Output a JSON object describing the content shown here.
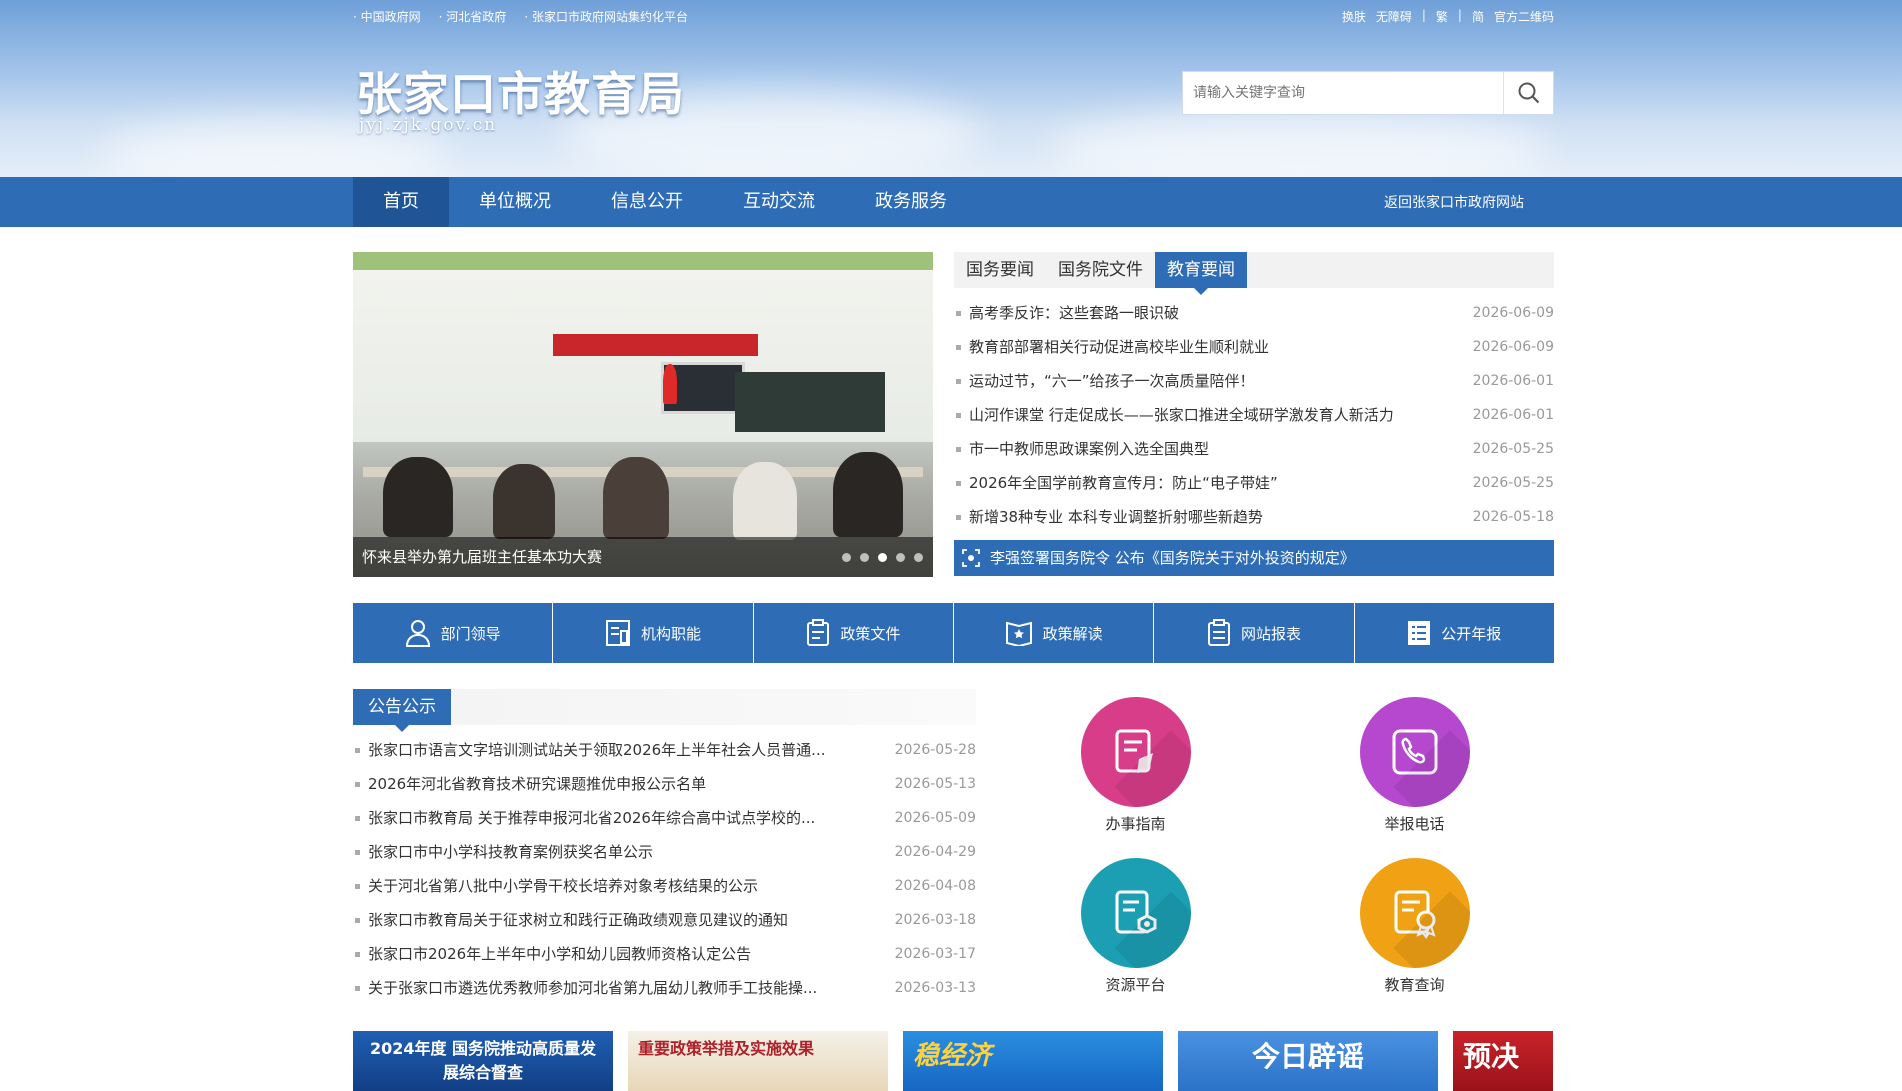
{
  "top_links": [
    "中国政府网",
    "河北省政府",
    "张家口市政府网站集约化平台"
  ],
  "toolbar": {
    "skin": "换肤",
    "accessible": "无障碍",
    "trad": "繁",
    "simp": "简",
    "qrcode": "官方二维码"
  },
  "site": {
    "title": "张家口市教育局",
    "url": "jyj.zjk.gov.cn"
  },
  "search": {
    "placeholder": "请输入关键字查询"
  },
  "nav": {
    "items": [
      "首页",
      "单位概况",
      "信息公开",
      "互动交流",
      "政务服务"
    ],
    "active": "首页",
    "back": "返回张家口市政府网站"
  },
  "slider": {
    "caption": "怀来县举办第九届班主任基本功大赛",
    "dots": 5,
    "active_dot": 3
  },
  "news": {
    "tabs": [
      "国务要闻",
      "国务院文件",
      "教育要闻"
    ],
    "active_tab": "教育要闻",
    "items": [
      {
        "title": "高考季反诈：这些套路一眼识破",
        "date": "2026-06-09"
      },
      {
        "title": "教育部部署相关行动促进高校毕业生顺利就业",
        "date": "2026-06-09"
      },
      {
        "title": "运动过节，“六一”给孩子一次高质量陪伴！",
        "date": "2026-06-01"
      },
      {
        "title": "山河作课堂 行走促成长——张家口推进全域研学激发育人新活力",
        "date": "2026-06-01"
      },
      {
        "title": "市一中教师思政课案例入选全国典型",
        "date": "2026-05-25"
      },
      {
        "title": "2026年全国学前教育宣传月：防止“电子带娃”",
        "date": "2026-05-25"
      },
      {
        "title": "新增38种专业 本科专业调整折射哪些新趋势",
        "date": "2026-05-18"
      }
    ],
    "notice": "李强签署国务院令 公布《国务院关于对外投资的规定》"
  },
  "quick": [
    "部门领导",
    "机构职能",
    "政策文件",
    "政策解读",
    "网站报表",
    "公开年报"
  ],
  "announce": {
    "title": "公告公示",
    "items": [
      {
        "title": "张家口市语言文字培训测试站关于领取2026年上半年社会人员普通...",
        "date": "2026-05-28"
      },
      {
        "title": "2026年河北省教育技术研究课题推优申报公示名单",
        "date": "2026-05-13"
      },
      {
        "title": "张家口市教育局 关于推荐申报河北省2026年综合高中试点学校的...",
        "date": "2026-05-09"
      },
      {
        "title": "张家口市中小学科技教育案例获奖名单公示",
        "date": "2026-04-29"
      },
      {
        "title": "关于河北省第八批中小学骨干校长培养对象考核结果的公示",
        "date": "2026-04-08"
      },
      {
        "title": "张家口市教育局关于征求树立和践行正确政绩观意见建议的通知",
        "date": "2026-03-18"
      },
      {
        "title": "张家口市2026年上半年中小学和幼儿园教师资格认定公告",
        "date": "2026-03-17"
      },
      {
        "title": "关于张家口市遴选优秀教师参加河北省第九届幼儿教师手工技能操...",
        "date": "2026-03-13"
      }
    ]
  },
  "services": [
    {
      "label": "办事指南",
      "color": "#d83d8a",
      "icon": "guide-icon"
    },
    {
      "label": "举报电话",
      "color": "#b548cf",
      "icon": "phone-icon"
    },
    {
      "label": "资源平台",
      "color": "#1c9fb3",
      "icon": "resource-icon"
    },
    {
      "label": "教育查询",
      "color": "#f0a114",
      "icon": "query-icon"
    }
  ],
  "banners": [
    "2024年度 国务院推动高质量发展综合督查",
    "重要政策举措及实施效果",
    "稳经济",
    "今日辟谣",
    "预决"
  ],
  "colors": {
    "primary": "#2e6cb5",
    "nav_active": "#1f5596"
  }
}
